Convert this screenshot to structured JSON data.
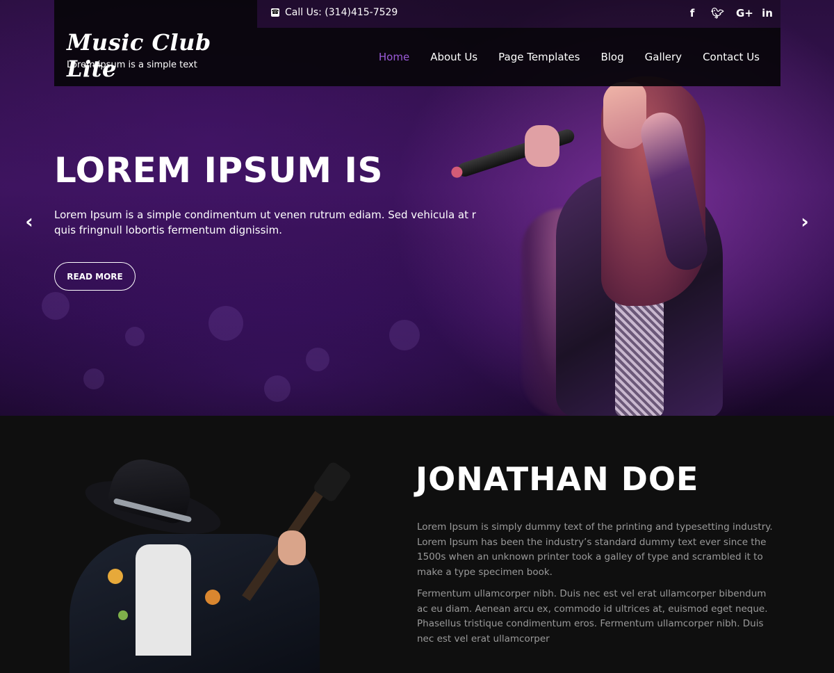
{
  "topbar": {
    "phone": "Call Us: (314)415-7529",
    "socials": [
      "facebook-icon",
      "twitter-icon",
      "google-plus-icon",
      "linkedin-icon"
    ]
  },
  "header": {
    "site_title": "Music Club Lite",
    "tagline": "Lorem ipsum is a simple text"
  },
  "nav": {
    "items": [
      "Home",
      "About Us",
      "Page Templates",
      "Blog",
      "Gallery",
      "Contact Us"
    ],
    "active": "Home"
  },
  "hero": {
    "title": "LOREM IPSUM IS",
    "description": "Lorem Ipsum is a simple condimentum ut venen rutrum ediam. Sed vehicula at r quis fringnull lobortis fermentum dignissim.",
    "button": "READ MORE"
  },
  "about": {
    "title": "JONATHAN DOE",
    "p1": "Lorem Ipsum is simply dummy text of the printing and typesetting industry. Lorem Ipsum has been the industry’s standard dummy text ever since the 1500s when an unknown printer took a galley of type and scrambled it to make a type specimen book.",
    "p2": "Fermentum ullamcorper nibh. Duis nec est vel erat ullamcorper bibendum ac eu diam. Aenean arcu ex, commodo id ultrices at, euismod eget neque. Phasellus tristique condimentum eros. Fermentum ullamcorper nibh. Duis nec est vel erat ullamcorper"
  },
  "colors": {
    "accent": "#9b5ad9",
    "background": "#0f0f0f",
    "muted_text": "#9a9a9a"
  }
}
